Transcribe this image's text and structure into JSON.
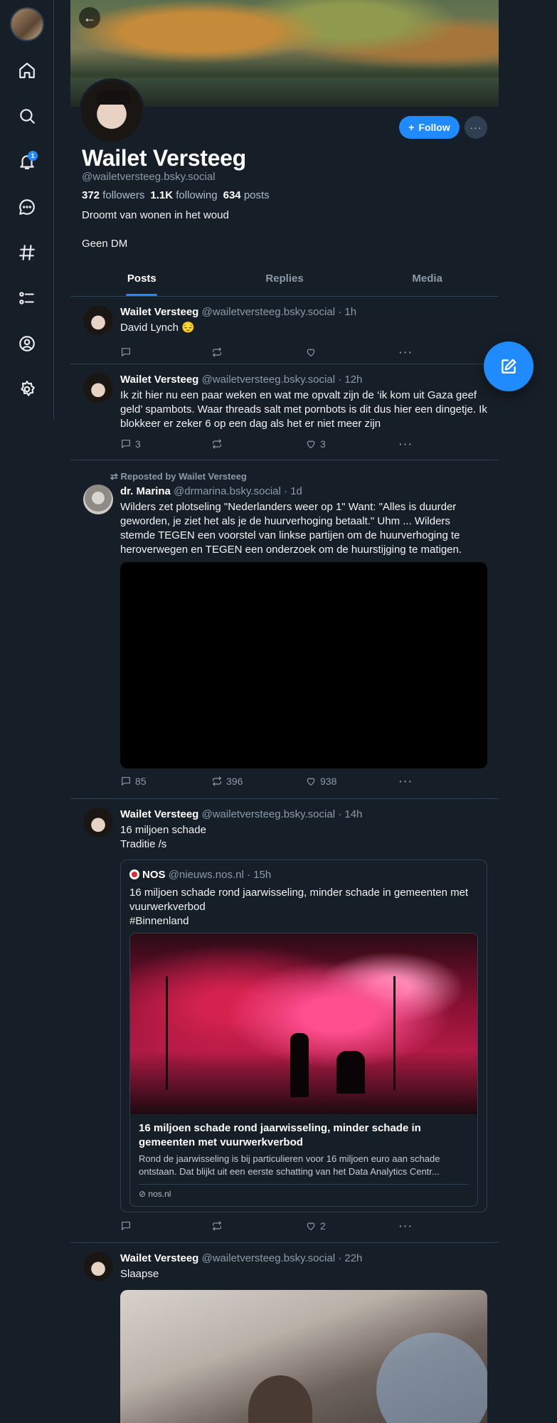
{
  "nav": {
    "items": [
      {
        "name": "home-icon"
      },
      {
        "name": "search-icon"
      },
      {
        "name": "notifications-icon",
        "badge": "1"
      },
      {
        "name": "chat-icon"
      },
      {
        "name": "feeds-hash-icon"
      },
      {
        "name": "lists-icon"
      },
      {
        "name": "profile-icon"
      },
      {
        "name": "settings-gear-icon"
      }
    ]
  },
  "profile": {
    "display_name": "Wailet Versteeg",
    "handle": "@wailetversteeg.bsky.social",
    "followers_count": "372",
    "followers_label": "followers",
    "following_count": "1.1K",
    "following_label": "following",
    "posts_count": "634",
    "posts_label": "posts",
    "bio_line1": "Droomt van wonen in het woud",
    "bio_line2": "Geen DM",
    "follow_label": "Follow",
    "more_label": "···"
  },
  "tabs": [
    "Posts",
    "Replies",
    "Media"
  ],
  "posts": [
    {
      "author": "Wailet Versteeg",
      "handle": "@wailetversteeg.bsky.social",
      "time": "1h",
      "text": "David Lynch 😔",
      "replies": "",
      "reposts": "",
      "likes": ""
    },
    {
      "author": "Wailet Versteeg",
      "handle": "@wailetversteeg.bsky.social",
      "time": "12h",
      "text": "Ik zit hier nu een paar weken en wat me opvalt zijn de ‘ik kom uit Gaza geef geld’ spambots. Waar threads salt met pornbots is dit dus hier een dingetje. Ik blokkeer er zeker 6 op een dag als het er niet meer zijn",
      "replies": "3",
      "reposts": "",
      "likes": "3"
    },
    {
      "repost_label": "Reposted by Wailet Versteeg",
      "author": "dr. Marina",
      "handle": "@drmarina.bsky.social",
      "time": "1d",
      "text": "Wilders zet plotseling \"Nederlanders weer op 1\" Want:  \"Alles is duurder geworden, je ziet het als je de huurverhoging betaalt.\" Uhm ... Wilders stemde TEGEN een voorstel van linkse partijen om de huurverhoging te heroverwegen en TEGEN een onderzoek om de huurstijging te matigen.",
      "replies": "85",
      "reposts": "396",
      "likes": "938"
    },
    {
      "author": "Wailet Versteeg",
      "handle": "@wailetversteeg.bsky.social",
      "time": "14h",
      "text_line1": "16 miljoen schade",
      "text_line2": "Traditie /s",
      "quote": {
        "author": "NOS",
        "handle": "@nieuws.nos.nl",
        "time": "15h",
        "text_line1": "16 miljoen schade rond jaarwisseling, minder schade in gemeenten met vuurwerkverbod",
        "text_line2": "#Binnenland",
        "link_title": "16 miljoen schade rond jaarwisseling, minder schade in gemeenten met vuurwerkverbod",
        "link_desc": "Rond de jaarwisseling is bij particulieren voor 16 miljoen euro aan schade ontstaan. Dat blijkt uit een eerste schatting van het Data Analytics Centr...",
        "link_domain": "nos.nl"
      },
      "replies": "",
      "reposts": "",
      "likes": "2"
    },
    {
      "author": "Wailet Versteeg",
      "handle": "@wailetversteeg.bsky.social",
      "time": "22h",
      "text": "Slaapse"
    }
  ],
  "colors": {
    "accent": "#208bfe",
    "background": "#161e27",
    "border": "#2e4052",
    "muted": "#8c9aa8"
  }
}
